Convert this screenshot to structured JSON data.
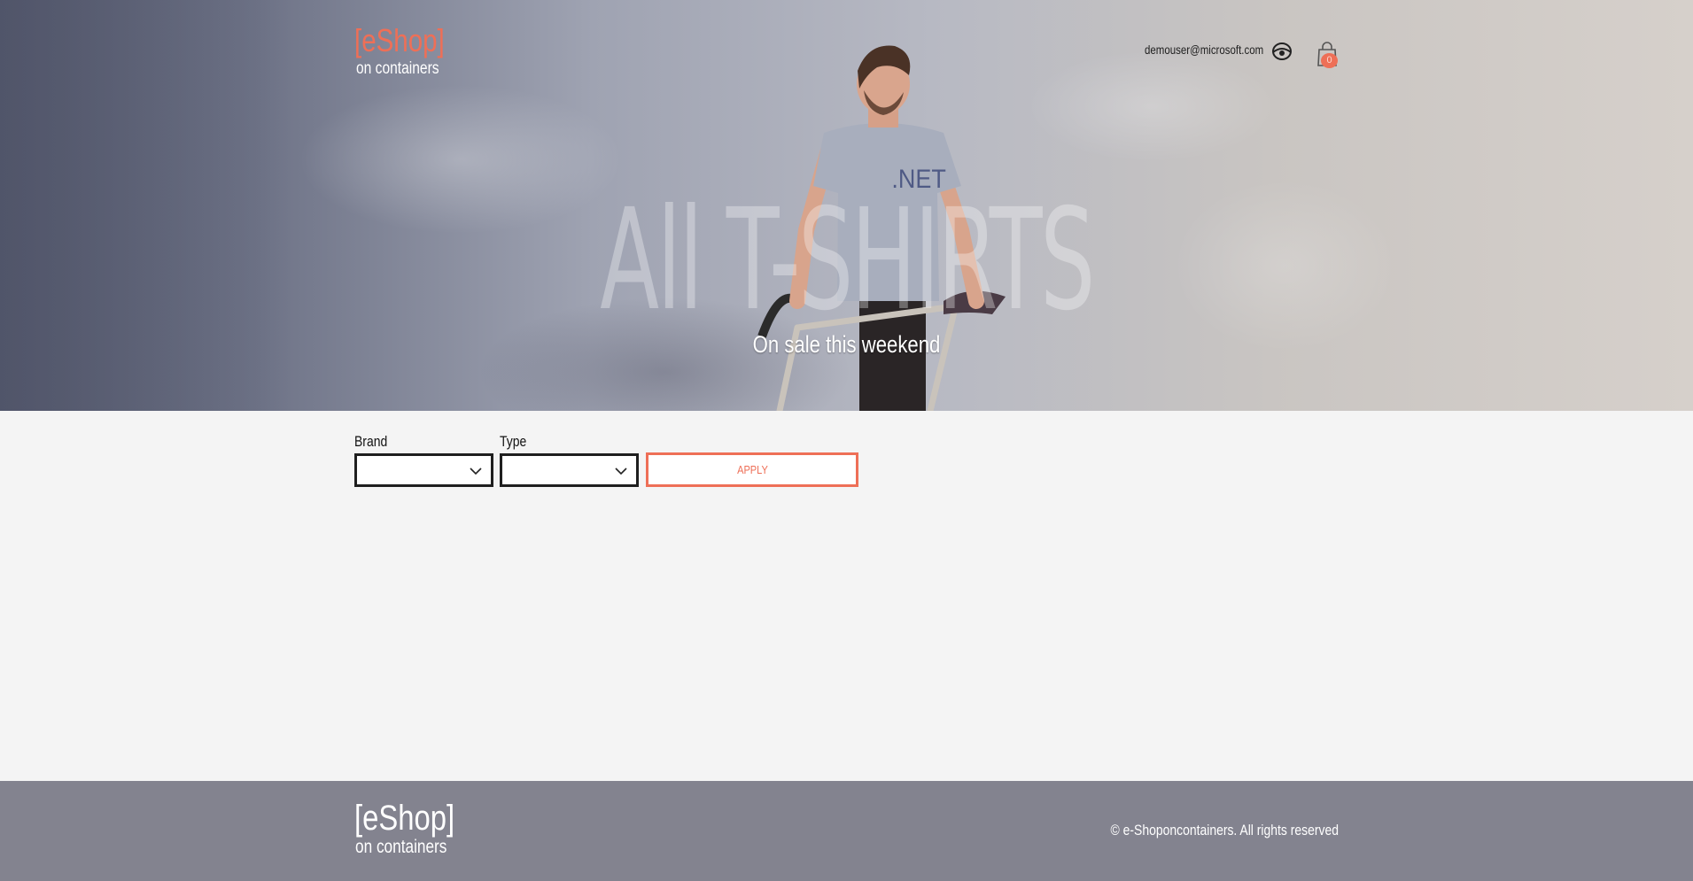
{
  "header": {
    "logo": "[eShop]",
    "tagline": "on containers",
    "user_email": "demouser@microsoft.com",
    "user_icon": "user-icon",
    "cart_icon": "shopping-bag-icon",
    "cart_count": "0"
  },
  "hero": {
    "title": "All T-SHIRTS",
    "subtitle": "On sale this weekend",
    "shirt_text": ".NET"
  },
  "filters": {
    "brand_label": "Brand",
    "brand_value": "",
    "type_label": "Type",
    "type_value": "",
    "apply_label": "APPLY"
  },
  "footer": {
    "logo": "[eShop]",
    "tagline": "on containers",
    "copyright": "© e-Shoponcontainers. All rights reserved"
  },
  "colors": {
    "accent": "#ee6f57",
    "footer_bg": "#83838f",
    "page_bg": "#f4f4f4"
  }
}
